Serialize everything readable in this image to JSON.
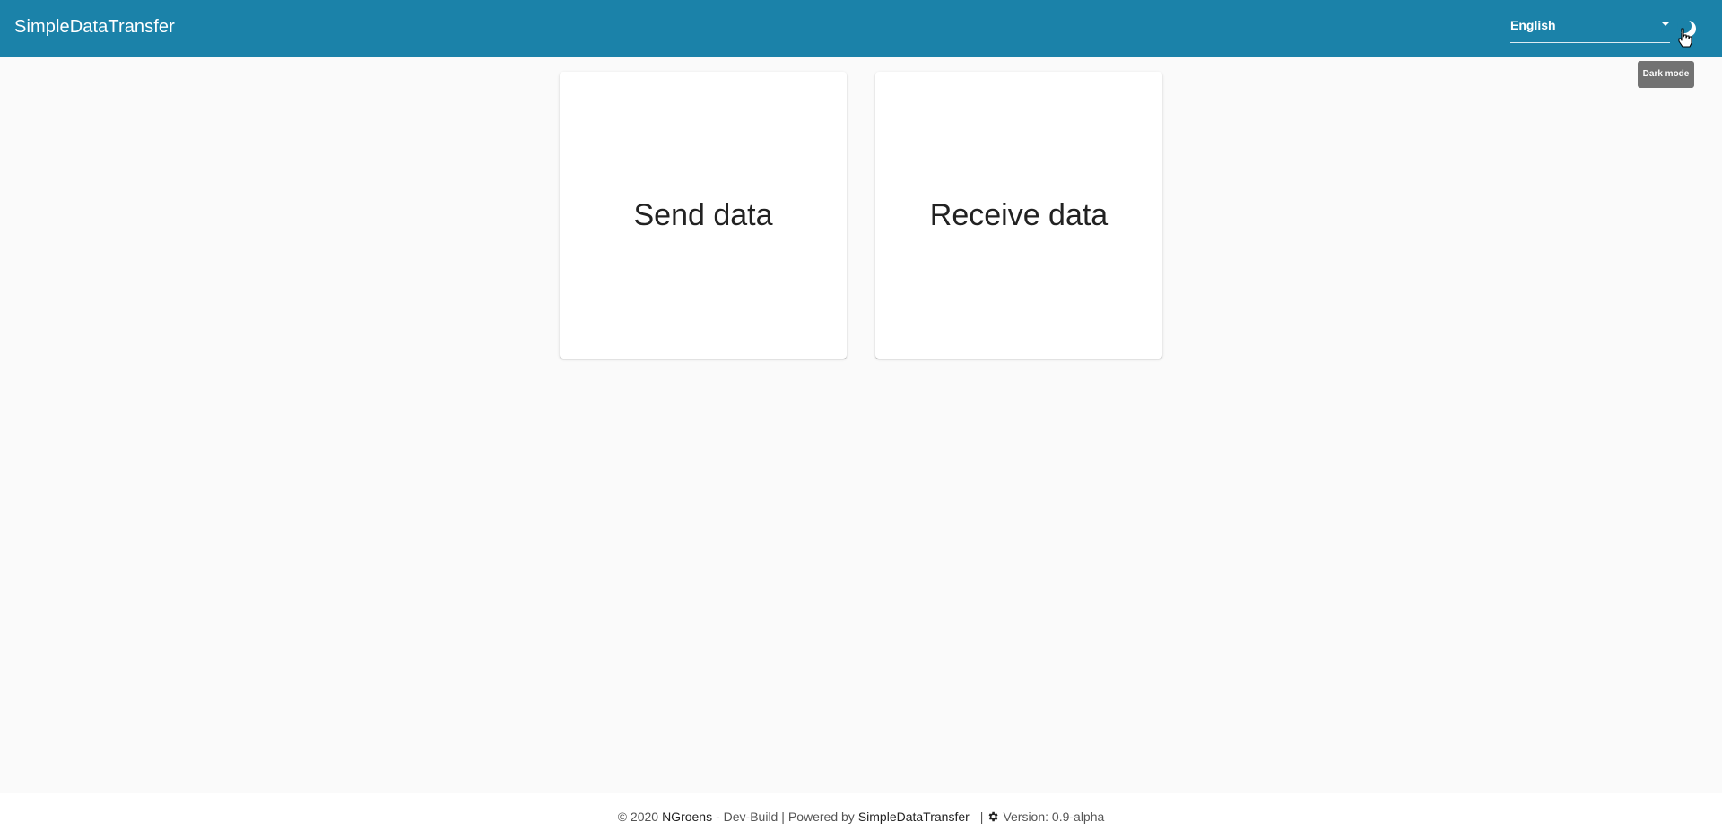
{
  "header": {
    "title": "SimpleDataTransfer",
    "language": {
      "selected": "English"
    },
    "theme_toggle": {
      "icon": "moon-icon",
      "tooltip": "Dark mode"
    }
  },
  "cards": [
    {
      "label": "Send data"
    },
    {
      "label": "Receive data"
    }
  ],
  "footer": {
    "copyright": "© 2020",
    "author": "NGroens",
    "build": "- Dev-Build |",
    "powered_by": "Powered by",
    "project": "SimpleDataTransfer",
    "divider": "|",
    "version": "Version: 0.9-alpha"
  },
  "colors": {
    "primary": "#1b82a9",
    "background": "#fafafa",
    "tooltip": "#6b6b6b"
  }
}
